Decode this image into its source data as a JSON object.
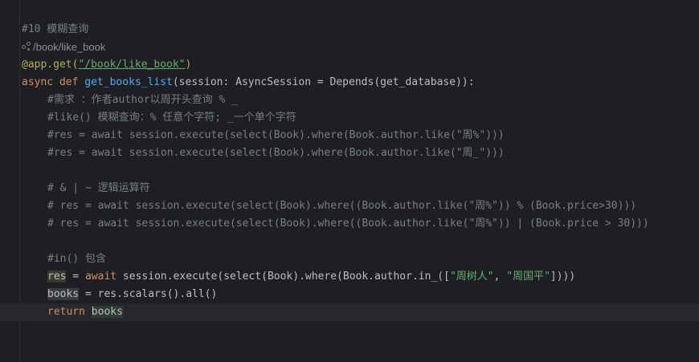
{
  "editor": {
    "lines": {
      "l1": "#10 模糊查询",
      "l2_url": "/book/like_book",
      "l3_deco": "@app.get(",
      "l3_str": "\"/book/like_book\"",
      "l3_end": ")",
      "l4_kw1": "async def ",
      "l4_fn": "get_books_list",
      "l4_rest": "(session: AsyncSession = Depends(get_database)):",
      "l5": "#需求 ：作者author以周开头查询 % _",
      "l6": "#like() 模糊查询：% 任意个字符; _一个单个字符",
      "l7": "#res = await session.execute(select(Book).where(Book.author.like(\"周%\")))",
      "l8": "#res = await session.execute(select(Book).where(Book.author.like(\"周_\")))",
      "l10": "# & | ~ 逻辑运算符",
      "l11": "# res = await session.execute(select(Book).where((Book.author.like(\"周%\")) % (Book.price>30)))",
      "l12": "# res = await session.execute(select(Book).where((Book.author.like(\"周%\")) | (Book.price > 30)))",
      "l14": "#in() 包含",
      "l15_var": "res",
      "l15_eq": " = ",
      "l15_kw": "await",
      "l15_mid": " session.execute(select(Book).where(Book.author.in_([",
      "l15_s1": "\"周树人\"",
      "l15_comma": ", ",
      "l15_s2": "\"周国平\"",
      "l15_end": "])))",
      "l16_var": "books",
      "l16_rest": " = res.scalars().all()",
      "l17_kw": "return ",
      "l17_var": "books"
    }
  }
}
